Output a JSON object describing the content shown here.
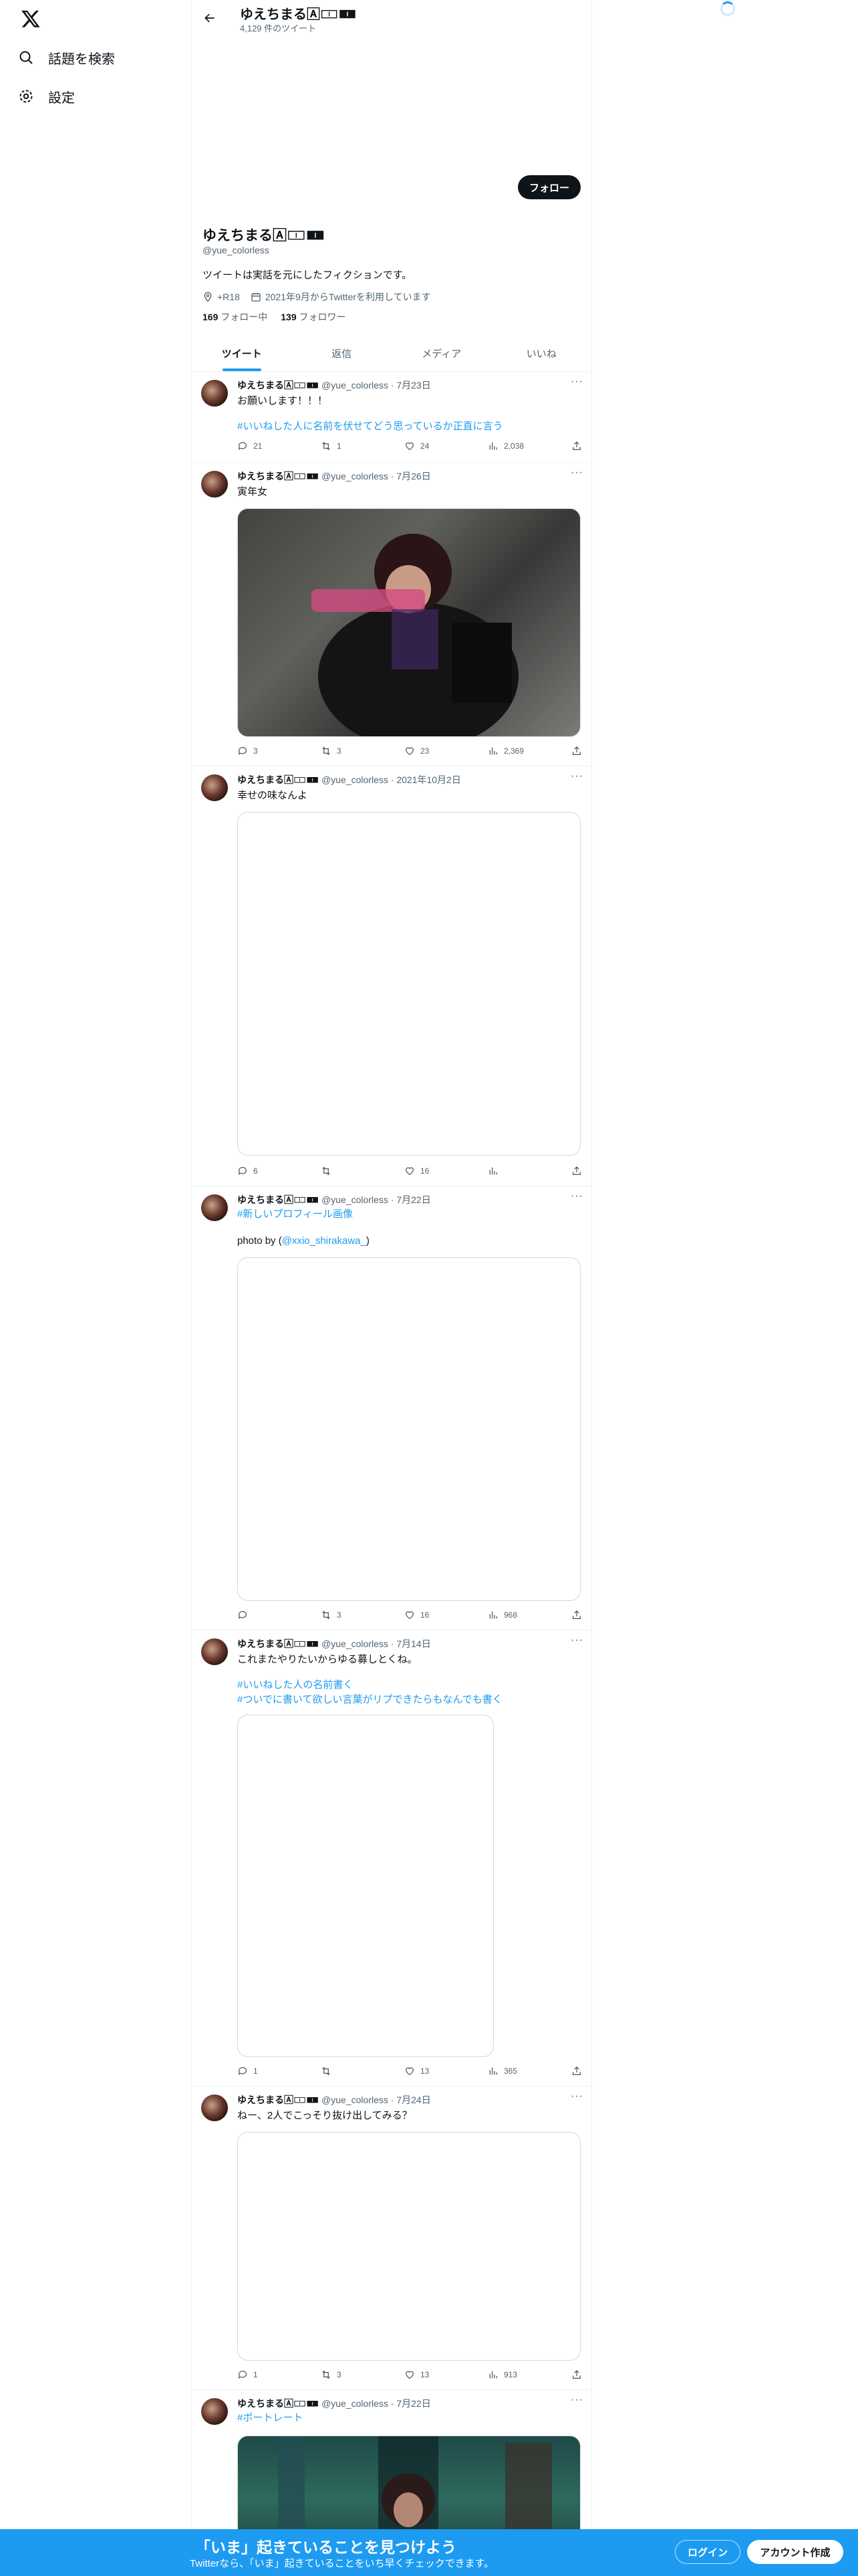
{
  "nav": {
    "explore_label": "話題を検索",
    "settings_label": "設定"
  },
  "header": {
    "name": "ゆえちまる🄰🀱🀰",
    "tweet_count": "4,129 件のツイート"
  },
  "profile": {
    "follow_label": "フォロー",
    "name": "ゆえちまる🄰🀱🀰",
    "handle": "@yue_colorless",
    "bio": "ツイートは実話を元にしたフィクションです。",
    "location": "+R18",
    "joined": "2021年9月からTwitterを利用しています",
    "following_count": "169",
    "following_label": "フォロー中",
    "followers_count": "139",
    "followers_label": "フォロワー"
  },
  "tabs": [
    "ツイート",
    "返信",
    "メディア",
    "いいね"
  ],
  "tweets": [
    {
      "name": "ゆえちまる🄰🀱🀰",
      "handle": "@yue_colorless",
      "date": "7月23日",
      "text1": "お願いします！！！",
      "text2": "#いいねした人に名前を伏せてどう思っているか正直に言う",
      "reply": "21",
      "retweet": "1",
      "like": "24",
      "views": "2,038"
    },
    {
      "name": "ゆえちまる🄰🀱🀰",
      "handle": "@yue_colorless",
      "date": "7月26日",
      "text1": "寅年女",
      "reply": "3",
      "retweet": "3",
      "like": "23",
      "views": "2,369"
    },
    {
      "name": "ゆえちまる🄰🀱🀰",
      "handle": "@yue_colorless",
      "date": "2021年10月2日",
      "text1": "幸せの味なんよ",
      "reply": "6",
      "retweet": "",
      "like": "16",
      "views": ""
    },
    {
      "name": "ゆえちまる🄰🀱🀰",
      "handle": "@yue_colorless",
      "date": "7月22日",
      "text1": "#新しいプロフィール画像",
      "text2_pre": "photo by (",
      "text2_link": "@xxio_shirakawa_",
      "text2_post": ")",
      "reply": "",
      "retweet": "3",
      "like": "16",
      "views": "968"
    },
    {
      "name": "ゆえちまる🄰🀱🀰",
      "handle": "@yue_colorless",
      "date": "7月14日",
      "text1": "これまたやりたいからゆる募しとくね。",
      "text2": "#いいねした人の名前書く",
      "text3": "#ついでに書いて欲しい言葉がリプできたらもなんでも書く",
      "reply": "1",
      "retweet": "",
      "like": "13",
      "views": "365"
    },
    {
      "name": "ゆえちまる🄰🀱🀰",
      "handle": "@yue_colorless",
      "date": "7月24日",
      "text1": "ねー、2人でこっそり抜け出してみる？",
      "reply": "1",
      "retweet": "3",
      "like": "13",
      "views": "913"
    },
    {
      "name": "ゆえちまる🄰🀱🀰",
      "handle": "@yue_colorless",
      "date": "7月22日",
      "text1": "#ポートレート"
    }
  ],
  "banner": {
    "title": "「いま」起きていることを見つけよう",
    "subtitle": "Twitterなら、「いま」起きていることをいち早くチェックできます。",
    "login_label": "ログイン",
    "signup_label": "アカウント作成"
  },
  "colors": {
    "accent": "#1d9bf0",
    "text": "#0f1419",
    "muted": "#536471"
  }
}
